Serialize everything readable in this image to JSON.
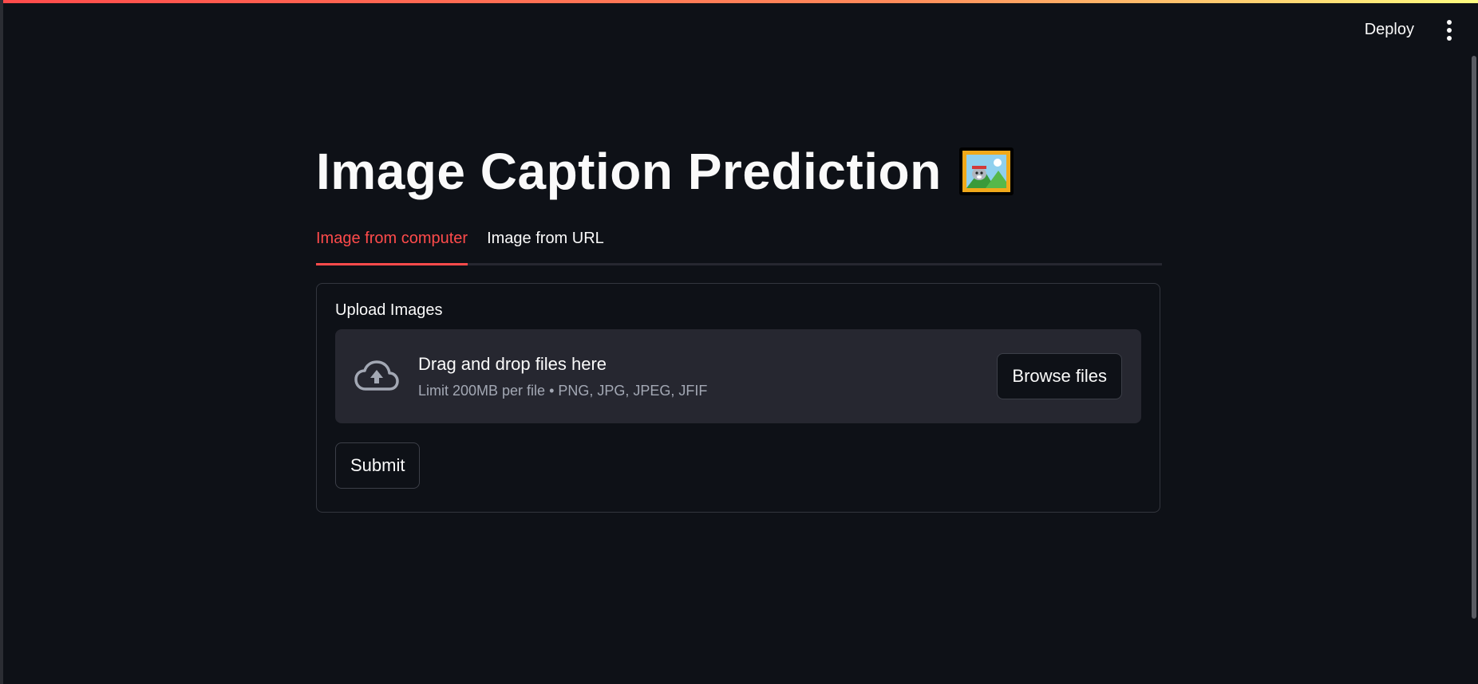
{
  "header": {
    "deploy_label": "Deploy",
    "menu_icon": "more-vertical-icon"
  },
  "colors": {
    "background": "#0e1117",
    "accent": "#ff4b4b",
    "dropzone": "#262730",
    "muted_text": "#a3a8b4"
  },
  "main": {
    "title": "Image Caption Prediction",
    "title_icon": "framed-picture-icon",
    "tabs": [
      {
        "label": "Image from computer",
        "active": true
      },
      {
        "label": "Image from URL",
        "active": false
      }
    ],
    "form": {
      "upload_label": "Upload Images",
      "dropzone": {
        "icon": "cloud-upload-icon",
        "instruction": "Drag and drop files here",
        "limits": "Limit 200MB per file • PNG, JPG, JPEG, JFIF",
        "browse_label": "Browse files"
      },
      "submit_label": "Submit"
    }
  }
}
